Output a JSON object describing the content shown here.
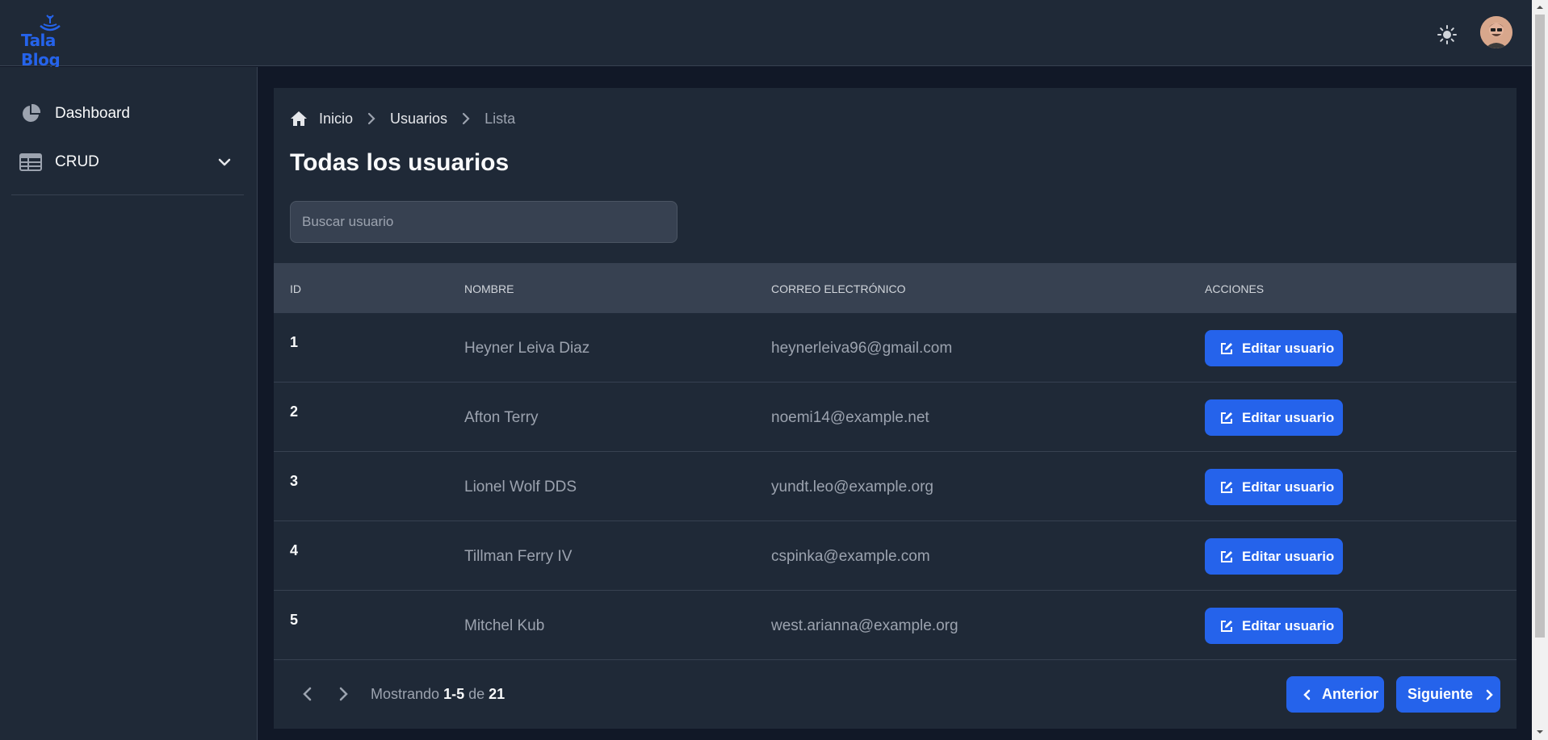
{
  "app": {
    "logo_text": "Tala Blog"
  },
  "header": {
    "theme_icon": "sun-icon",
    "avatar": "user-avatar"
  },
  "sidebar": {
    "items": [
      {
        "label": "Dashboard",
        "icon": "pie-chart-icon"
      },
      {
        "label": "CRUD",
        "icon": "table-icon",
        "expand_icon": "chevron-down-icon"
      }
    ]
  },
  "breadcrumb": {
    "home": "Inicio",
    "section": "Usuarios",
    "current": "Lista"
  },
  "page": {
    "title": "Todas los usuarios"
  },
  "search": {
    "placeholder": "Buscar usuario",
    "value": ""
  },
  "table": {
    "headers": {
      "id": "ID",
      "name": "NOMBRE",
      "email": "CORREO ELECTRÓNICO",
      "actions": "ACCIONES"
    },
    "rows": [
      {
        "id": "1",
        "name": "Heyner Leiva Diaz",
        "email": "heynerleiva96@gmail.com",
        "action": "Editar usuario"
      },
      {
        "id": "2",
        "name": "Afton Terry",
        "email": "noemi14@example.net",
        "action": "Editar usuario"
      },
      {
        "id": "3",
        "name": "Lionel Wolf DDS",
        "email": "yundt.leo@example.org",
        "action": "Editar usuario"
      },
      {
        "id": "4",
        "name": "Tillman Ferry IV",
        "email": "cspinka@example.com",
        "action": "Editar usuario"
      },
      {
        "id": "5",
        "name": "Mitchel Kub",
        "email": "west.arianna@example.org",
        "action": "Editar usuario"
      }
    ]
  },
  "pagination": {
    "showing_prefix": "Mostrando",
    "range": "1-5",
    "of": "de",
    "total": "21",
    "prev_label": "Anterior",
    "next_label": "Siguiente"
  },
  "colors": {
    "accent": "#2563eb",
    "panel": "#1f2937",
    "background": "#111827"
  }
}
